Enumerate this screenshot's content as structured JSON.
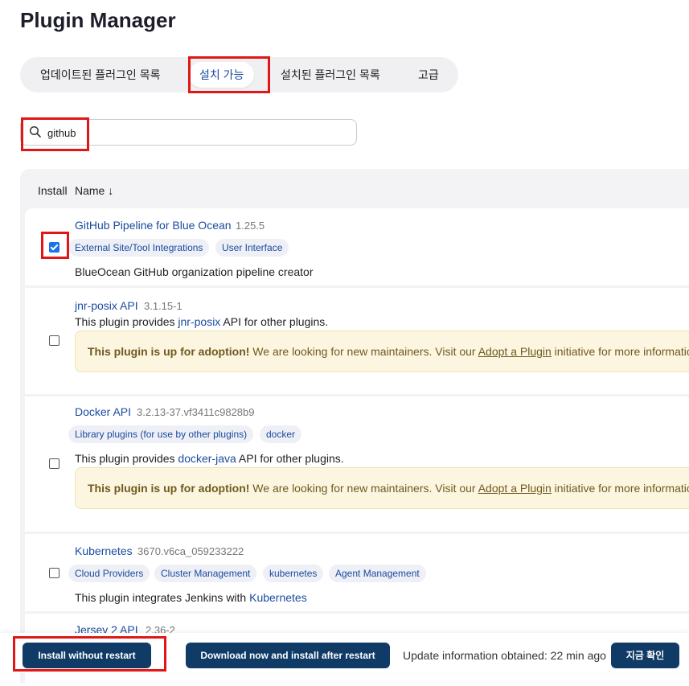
{
  "page": {
    "title": "Plugin Manager"
  },
  "tabs": [
    {
      "label": "업데이트된 플러그인 목록"
    },
    {
      "label": "설치 가능",
      "active": true
    },
    {
      "label": "설치된 플러그인 목록"
    },
    {
      "label": "고급"
    }
  ],
  "search": {
    "value": "github",
    "icon": "search-icon"
  },
  "table": {
    "headers": {
      "install": "Install",
      "name": "Name ↓"
    },
    "rows": [
      {
        "name": "GitHub Pipeline for Blue Ocean",
        "version": "1.25.5",
        "checked": true,
        "tags": [
          "External Site/Tool Integrations",
          "User Interface"
        ],
        "description": "BlueOcean GitHub organization pipeline creator"
      },
      {
        "name": "jnr-posix API",
        "version": "3.1.15-1",
        "checked": false,
        "desc_pre": "This plugin provides ",
        "desc_link": "jnr-posix",
        "desc_post": " API for other plugins."
      },
      {
        "name": "Docker API",
        "version": "3.2.13-37.vf3411c9828b9",
        "checked": false,
        "tags": [
          "Library plugins (for use by other plugins)",
          "docker"
        ],
        "desc_pre": "This plugin provides ",
        "desc_link": "docker-java",
        "desc_post": " API for other plugins."
      },
      {
        "name": "Kubernetes",
        "version": "3670.v6ca_059233222",
        "checked": false,
        "tags": [
          "Cloud Providers",
          "Cluster Management",
          "kubernetes",
          "Agent Management"
        ],
        "desc_pre": "This plugin integrates Jenkins with ",
        "desc_link": "Kubernetes"
      },
      {
        "name": "Jersey 2 API",
        "version": "2.36-2"
      }
    ]
  },
  "adoption": {
    "bold": "This plugin is up for adoption!",
    "text": " We are looking for new maintainers. Visit our ",
    "link": "Adopt a Plugin",
    "post": " initiative for more information."
  },
  "bottom_bar": {
    "install_button": "Install without restart",
    "download_button": "Download now and install after restart",
    "status": "Update information obtained: 22 min ago",
    "check_button": "지금 확인"
  },
  "colors": {
    "accent": "#1a4ba0",
    "button": "#0f3b66",
    "highlight": "#e11616",
    "adopt_bg": "#fcf6e0"
  }
}
